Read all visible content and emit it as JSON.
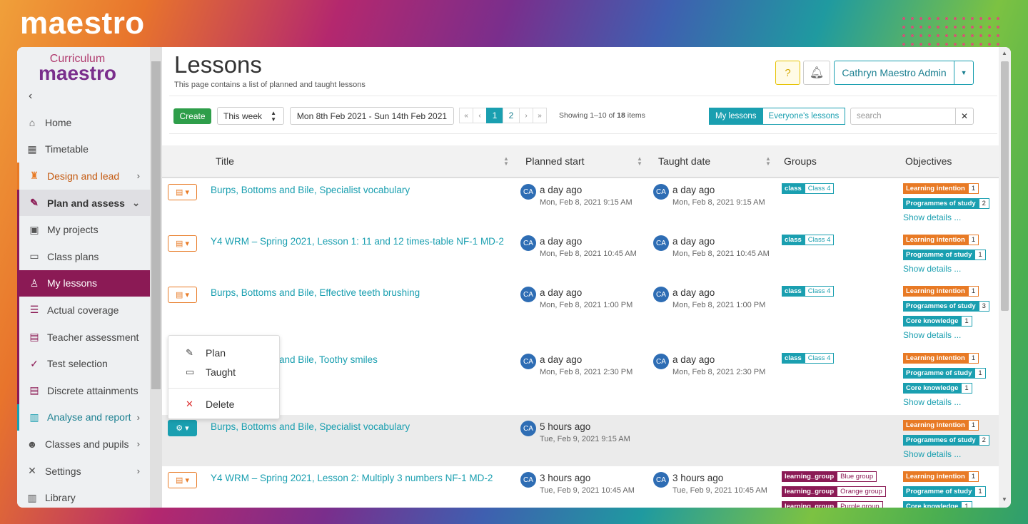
{
  "brand": "maestro",
  "logo": {
    "line1": "Curriculum",
    "line2": "maestro"
  },
  "sidebar": {
    "collapse_icon": "chevron-left-icon",
    "items": [
      {
        "label": "Home",
        "icon": "home-icon"
      },
      {
        "label": "Timetable",
        "icon": "calendar-icon"
      },
      {
        "label": "Design and lead",
        "icon": "design-icon",
        "chevron": "›"
      },
      {
        "label": "Plan and assess",
        "icon": "plan-icon",
        "chevron": "⌄"
      },
      {
        "label": "My projects",
        "icon": "projects-icon"
      },
      {
        "label": "Class plans",
        "icon": "folder-icon"
      },
      {
        "label": "My lessons",
        "icon": "lessons-icon"
      },
      {
        "label": "Actual coverage",
        "icon": "coverage-icon"
      },
      {
        "label": "Teacher assessment",
        "icon": "clipboard-icon"
      },
      {
        "label": "Test selection",
        "icon": "check-icon"
      },
      {
        "label": "Discrete attainments",
        "icon": "clipboard-icon"
      },
      {
        "label": "Analyse and report",
        "icon": "chart-icon",
        "chevron": "›"
      },
      {
        "label": "Classes and pupils",
        "icon": "users-icon",
        "chevron": "›"
      },
      {
        "label": "Settings",
        "icon": "tools-icon",
        "chevron": "›"
      },
      {
        "label": "Library",
        "icon": "library-icon"
      }
    ]
  },
  "header": {
    "title": "Lessons",
    "subtitle": "This page contains a list of planned and taught lessons",
    "help_icon": "?",
    "user": "Cathryn Maestro Admin"
  },
  "toolbar": {
    "create": "Create",
    "period": "This week",
    "daterange": "Mon 8th Feb 2021 - Sun 14th Feb 2021",
    "pager": [
      "«",
      "‹",
      "1",
      "2",
      "›",
      "»"
    ],
    "showing_prefix": "Showing 1–10 of ",
    "showing_count": "18",
    "showing_suffix": " items",
    "seg_on": "My lessons",
    "seg_off": "Everyone's lessons",
    "search_placeholder": "search",
    "clear": "✕"
  },
  "table": {
    "columns": [
      "Title",
      "Planned start",
      "Taught date",
      "Groups",
      "Objectives"
    ],
    "show_details": "Show details ...",
    "avatar": "CA",
    "rows": [
      {
        "title": "Burps, Bottoms and Bile, Specialist vocabulary",
        "planned_ago": "a day ago",
        "planned_dt": "Mon, Feb 8, 2021 9:15 AM",
        "taught_ago": "a day ago",
        "taught_dt": "Mon, Feb 8, 2021 9:15 AM",
        "groups": [
          {
            "k": "class",
            "v": "Class 4"
          }
        ],
        "objectives": [
          {
            "k": "Learning intention",
            "v": "1"
          },
          {
            "k": "Programmes of study",
            "v": "2"
          }
        ]
      },
      {
        "title": "Y4 WRM – Spring 2021, Lesson 1: 11 and 12 times-table NF-1 MD-2",
        "planned_ago": "a day ago",
        "planned_dt": "Mon, Feb 8, 2021 10:45 AM",
        "taught_ago": "a day ago",
        "taught_dt": "Mon, Feb 8, 2021 10:45 AM",
        "groups": [
          {
            "k": "class",
            "v": "Class 4"
          }
        ],
        "objectives": [
          {
            "k": "Learning intention",
            "v": "1"
          },
          {
            "k": "Programme of study",
            "v": "1"
          }
        ]
      },
      {
        "title": "Burps, Bottoms and Bile, Effective teeth brushing",
        "planned_ago": "a day ago",
        "planned_dt": "Mon, Feb 8, 2021 1:00 PM",
        "taught_ago": "a day ago",
        "taught_dt": "Mon, Feb 8, 2021 1:00 PM",
        "groups": [
          {
            "k": "class",
            "v": "Class 4"
          }
        ],
        "objectives": [
          {
            "k": "Learning intention",
            "v": "1"
          },
          {
            "k": "Programmes of study",
            "v": "3"
          },
          {
            "k": "Core knowledge",
            "v": "1"
          }
        ]
      },
      {
        "title": "and Bile, Toothy smiles",
        "planned_ago": "a day ago",
        "planned_dt": "Mon, Feb 8, 2021 2:30 PM",
        "taught_ago": "a day ago",
        "taught_dt": "Mon, Feb 8, 2021 2:30 PM",
        "groups": [
          {
            "k": "class",
            "v": "Class 4"
          }
        ],
        "objectives": [
          {
            "k": "Learning intention",
            "v": "1"
          },
          {
            "k": "Programme of study",
            "v": "1"
          },
          {
            "k": "Core knowledge",
            "v": "1"
          }
        ]
      },
      {
        "title": "Burps, Bottoms and Bile, Specialist vocabulary",
        "planned_ago": "5 hours ago",
        "planned_dt": "Tue, Feb 9, 2021 9:15 AM",
        "objectives": [
          {
            "k": "Learning intention",
            "v": "1"
          },
          {
            "k": "Programmes of study",
            "v": "2"
          }
        ]
      },
      {
        "title": "Y4 WRM – Spring 2021, Lesson 2: Multiply 3 numbers NF-1 MD-2",
        "planned_ago": "3 hours ago",
        "planned_dt": "Tue, Feb 9, 2021 10:45 AM",
        "taught_ago": "3 hours ago",
        "taught_dt": "Tue, Feb 9, 2021 10:45 AM",
        "groups": [
          {
            "k": "learning_group",
            "v": "Blue group"
          },
          {
            "k": "learning_group",
            "v": "Orange group"
          },
          {
            "k": "learning_group",
            "v": "Purple group"
          }
        ],
        "objectives": [
          {
            "k": "Learning intention",
            "v": "1"
          },
          {
            "k": "Programme of study",
            "v": "1"
          },
          {
            "k": "Core knowledge",
            "v": "1"
          }
        ]
      }
    ]
  },
  "menu": {
    "plan": "Plan",
    "taught": "Taught",
    "delete": "Delete"
  }
}
